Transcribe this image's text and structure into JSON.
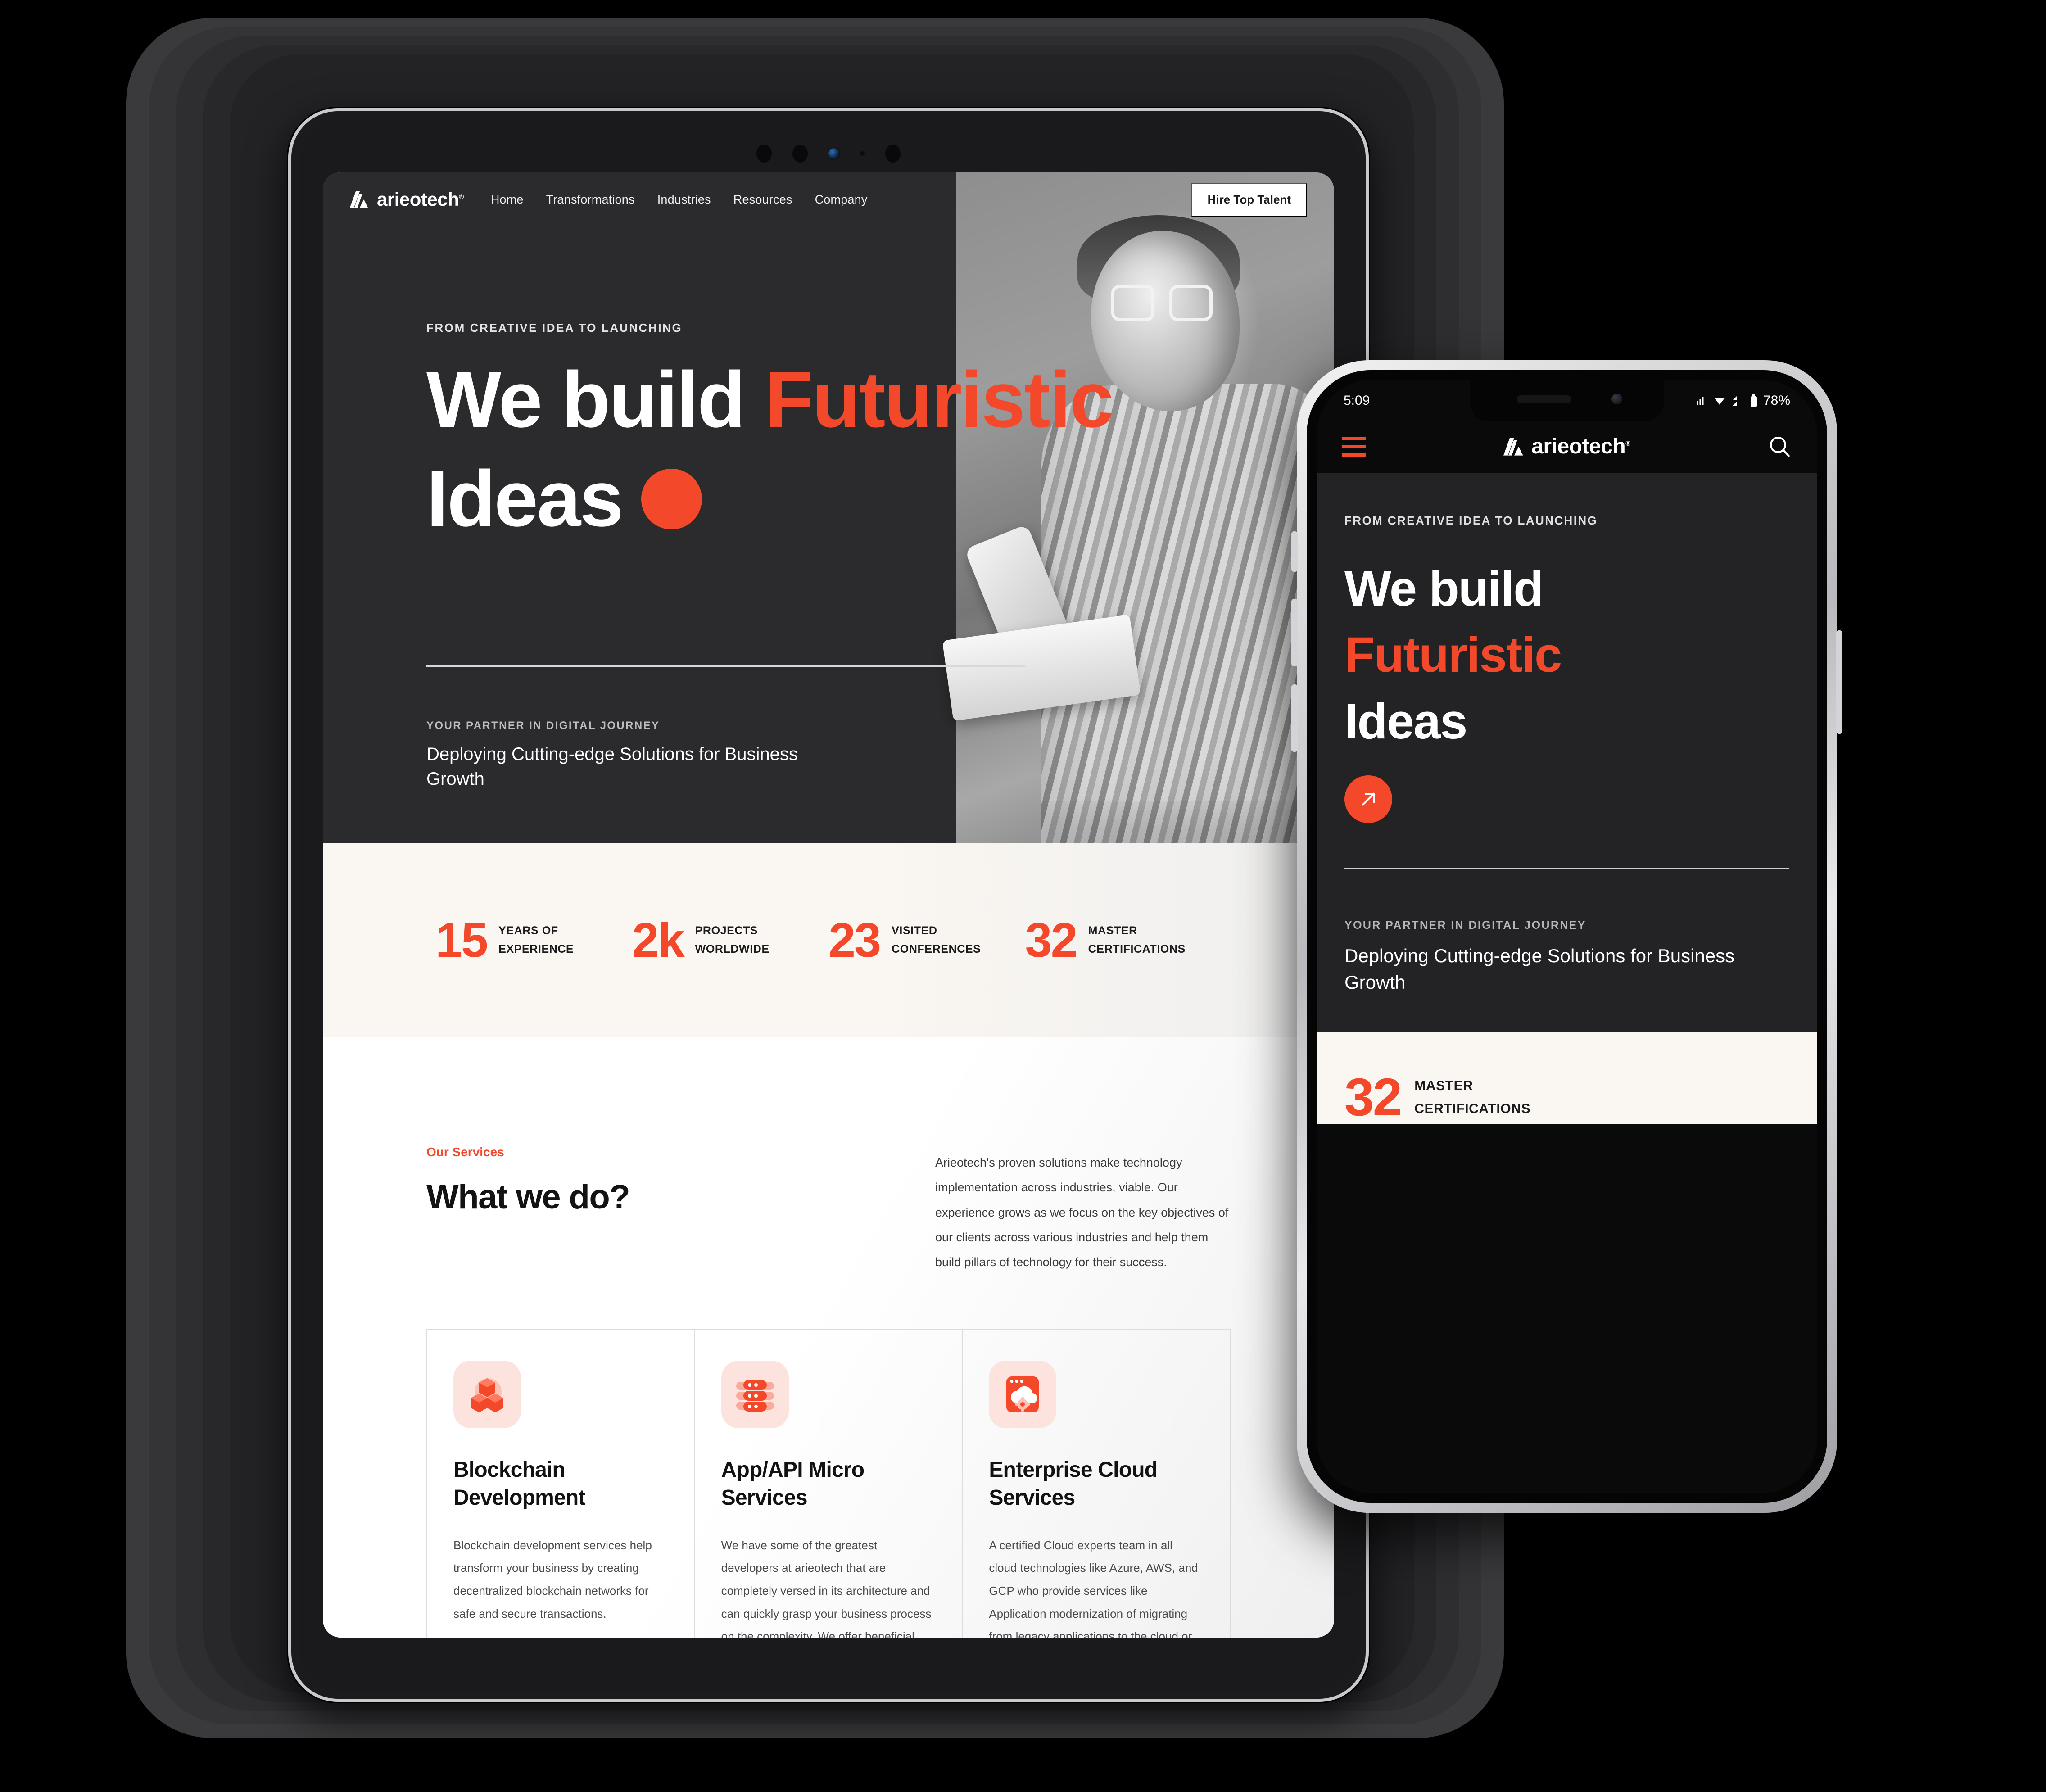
{
  "brand": {
    "name": "arieotech",
    "reg": "®"
  },
  "tablet": {
    "nav": {
      "links": [
        "Home",
        "Transformations",
        "Industries",
        "Resources",
        "Company"
      ],
      "cta": "Hire Top Talent"
    },
    "hero": {
      "eyebrow": "FROM CREATIVE IDEA TO LAUNCHING",
      "line1_white": "We build ",
      "line1_accent": "Futuristic",
      "line2": "Ideas",
      "sub_eyebrow": "YOUR PARTNER IN DIGITAL JOURNEY",
      "sub_title": "Deploying Cutting-edge Solutions for Business Growth"
    },
    "stats": [
      {
        "num": "15",
        "line1": "YEARS OF",
        "line2": "EXPERIENCE"
      },
      {
        "num": "2k",
        "line1": "PROJECTS",
        "line2": "WORLDWIDE"
      },
      {
        "num": "23",
        "line1": "VISITED",
        "line2": "CONFERENCES"
      },
      {
        "num": "32",
        "line1": "MASTER",
        "line2": "CERTIFICATIONS"
      }
    ],
    "services": {
      "kicker": "Our Services",
      "title": "What we do?",
      "paragraph": "Arieotech's proven solutions make technology implementation across industries, viable. Our experience grows as we focus on the key objectives of our clients across various industries and help them build pillars of technology for their success.",
      "cards": [
        {
          "icon": "blockchain-cubes-icon",
          "title": "Blockchain Development",
          "text": "Blockchain development services help transform your business by creating decentralized blockchain networks for safe and secure transactions."
        },
        {
          "icon": "server-stack-icon",
          "title": "App/API Micro Services",
          "text": "We have some of the greatest developers at arieotech that are completely versed in its architecture and can quickly grasp your business process on the complexity. We offer beneficial options for you, whether you're a small or developing firm or a large corporation."
        },
        {
          "icon": "cloud-gear-window-icon",
          "title": "Enterprise Cloud Services",
          "text": "A certified Cloud experts team in all cloud technologies like Azure, AWS, and GCP who provide services like Application modernization of migrating from legacy applications to the cloud or building a new project/solution. Our team will analyse your current need and provide the optimum and best-fit solution in a cost-effective and scalable fashion"
        }
      ]
    }
  },
  "phone": {
    "status": {
      "time": "5:09",
      "battery": "78%"
    },
    "header": {
      "menu_icon": "hamburger-menu-icon",
      "search_icon": "search-icon"
    },
    "hero": {
      "eyebrow": "FROM CREATIVE IDEA TO LAUNCHING",
      "line1": "We build",
      "line2_accent": "Futuristic",
      "line3": "Ideas",
      "cta_icon": "arrow-up-right-icon",
      "sub_eyebrow": "YOUR PARTNER IN DIGITAL JOURNEY",
      "sub_title": "Deploying Cutting-edge Solutions for Business Growth"
    },
    "stat": {
      "num": "32",
      "line1": "MASTER",
      "line2": "CERTIFICATIONS"
    }
  },
  "colors": {
    "accent": "#f4482a",
    "dark": "#232325",
    "cream": "#faf6f1"
  }
}
